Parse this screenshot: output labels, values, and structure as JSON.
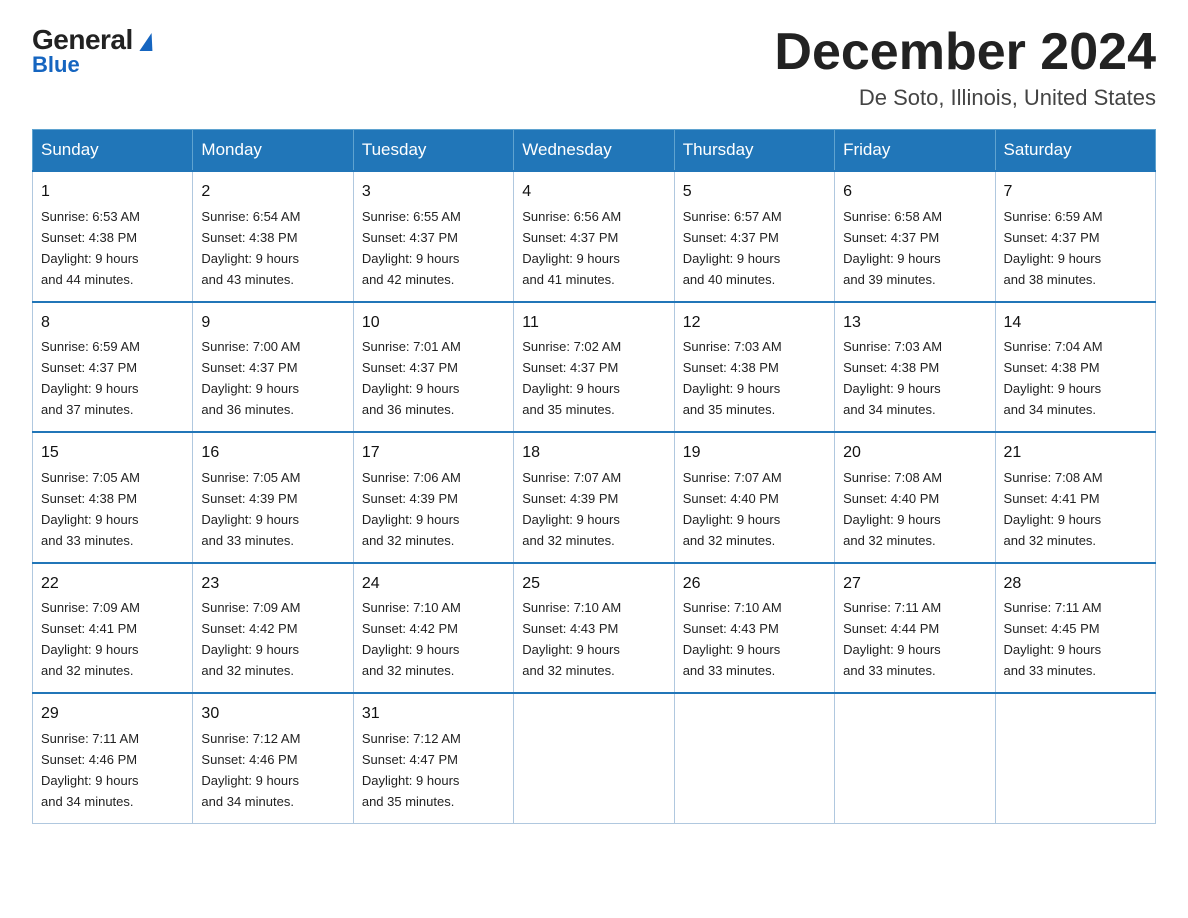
{
  "logo": {
    "part1": "General",
    "part2": "Blue"
  },
  "header": {
    "month": "December 2024",
    "location": "De Soto, Illinois, United States"
  },
  "days_of_week": [
    "Sunday",
    "Monday",
    "Tuesday",
    "Wednesday",
    "Thursday",
    "Friday",
    "Saturday"
  ],
  "weeks": [
    [
      {
        "day": 1,
        "sunrise": "6:53 AM",
        "sunset": "4:38 PM",
        "daylight": "9 hours and 44 minutes."
      },
      {
        "day": 2,
        "sunrise": "6:54 AM",
        "sunset": "4:38 PM",
        "daylight": "9 hours and 43 minutes."
      },
      {
        "day": 3,
        "sunrise": "6:55 AM",
        "sunset": "4:37 PM",
        "daylight": "9 hours and 42 minutes."
      },
      {
        "day": 4,
        "sunrise": "6:56 AM",
        "sunset": "4:37 PM",
        "daylight": "9 hours and 41 minutes."
      },
      {
        "day": 5,
        "sunrise": "6:57 AM",
        "sunset": "4:37 PM",
        "daylight": "9 hours and 40 minutes."
      },
      {
        "day": 6,
        "sunrise": "6:58 AM",
        "sunset": "4:37 PM",
        "daylight": "9 hours and 39 minutes."
      },
      {
        "day": 7,
        "sunrise": "6:59 AM",
        "sunset": "4:37 PM",
        "daylight": "9 hours and 38 minutes."
      }
    ],
    [
      {
        "day": 8,
        "sunrise": "6:59 AM",
        "sunset": "4:37 PM",
        "daylight": "9 hours and 37 minutes."
      },
      {
        "day": 9,
        "sunrise": "7:00 AM",
        "sunset": "4:37 PM",
        "daylight": "9 hours and 36 minutes."
      },
      {
        "day": 10,
        "sunrise": "7:01 AM",
        "sunset": "4:37 PM",
        "daylight": "9 hours and 36 minutes."
      },
      {
        "day": 11,
        "sunrise": "7:02 AM",
        "sunset": "4:37 PM",
        "daylight": "9 hours and 35 minutes."
      },
      {
        "day": 12,
        "sunrise": "7:03 AM",
        "sunset": "4:38 PM",
        "daylight": "9 hours and 35 minutes."
      },
      {
        "day": 13,
        "sunrise": "7:03 AM",
        "sunset": "4:38 PM",
        "daylight": "9 hours and 34 minutes."
      },
      {
        "day": 14,
        "sunrise": "7:04 AM",
        "sunset": "4:38 PM",
        "daylight": "9 hours and 34 minutes."
      }
    ],
    [
      {
        "day": 15,
        "sunrise": "7:05 AM",
        "sunset": "4:38 PM",
        "daylight": "9 hours and 33 minutes."
      },
      {
        "day": 16,
        "sunrise": "7:05 AM",
        "sunset": "4:39 PM",
        "daylight": "9 hours and 33 minutes."
      },
      {
        "day": 17,
        "sunrise": "7:06 AM",
        "sunset": "4:39 PM",
        "daylight": "9 hours and 32 minutes."
      },
      {
        "day": 18,
        "sunrise": "7:07 AM",
        "sunset": "4:39 PM",
        "daylight": "9 hours and 32 minutes."
      },
      {
        "day": 19,
        "sunrise": "7:07 AM",
        "sunset": "4:40 PM",
        "daylight": "9 hours and 32 minutes."
      },
      {
        "day": 20,
        "sunrise": "7:08 AM",
        "sunset": "4:40 PM",
        "daylight": "9 hours and 32 minutes."
      },
      {
        "day": 21,
        "sunrise": "7:08 AM",
        "sunset": "4:41 PM",
        "daylight": "9 hours and 32 minutes."
      }
    ],
    [
      {
        "day": 22,
        "sunrise": "7:09 AM",
        "sunset": "4:41 PM",
        "daylight": "9 hours and 32 minutes."
      },
      {
        "day": 23,
        "sunrise": "7:09 AM",
        "sunset": "4:42 PM",
        "daylight": "9 hours and 32 minutes."
      },
      {
        "day": 24,
        "sunrise": "7:10 AM",
        "sunset": "4:42 PM",
        "daylight": "9 hours and 32 minutes."
      },
      {
        "day": 25,
        "sunrise": "7:10 AM",
        "sunset": "4:43 PM",
        "daylight": "9 hours and 32 minutes."
      },
      {
        "day": 26,
        "sunrise": "7:10 AM",
        "sunset": "4:43 PM",
        "daylight": "9 hours and 33 minutes."
      },
      {
        "day": 27,
        "sunrise": "7:11 AM",
        "sunset": "4:44 PM",
        "daylight": "9 hours and 33 minutes."
      },
      {
        "day": 28,
        "sunrise": "7:11 AM",
        "sunset": "4:45 PM",
        "daylight": "9 hours and 33 minutes."
      }
    ],
    [
      {
        "day": 29,
        "sunrise": "7:11 AM",
        "sunset": "4:46 PM",
        "daylight": "9 hours and 34 minutes."
      },
      {
        "day": 30,
        "sunrise": "7:12 AM",
        "sunset": "4:46 PM",
        "daylight": "9 hours and 34 minutes."
      },
      {
        "day": 31,
        "sunrise": "7:12 AM",
        "sunset": "4:47 PM",
        "daylight": "9 hours and 35 minutes."
      },
      null,
      null,
      null,
      null
    ]
  ]
}
